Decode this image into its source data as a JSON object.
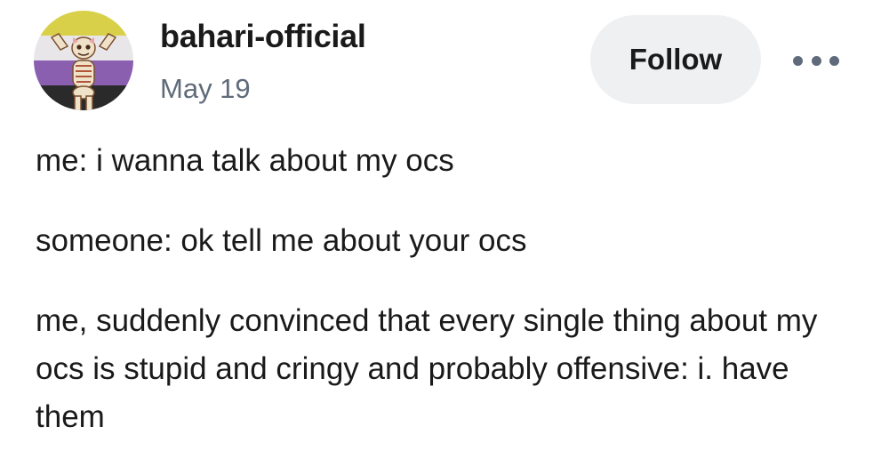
{
  "post": {
    "author": "bahari-official",
    "date": "May 19",
    "follow_label": "Follow",
    "more_icon": "more-horizontal-icon",
    "avatar": "skeleton-avatar",
    "paragraphs": [
      "me: i wanna talk about my ocs",
      "someone: ok tell me about your ocs",
      "me, suddenly convinced that every single thing about my ocs is stupid and cringy and probably offensive: i. have them"
    ]
  },
  "colors": {
    "follow_bg": "#eef0f2",
    "date": "#5f6b7a",
    "text": "#1a1a1a"
  }
}
